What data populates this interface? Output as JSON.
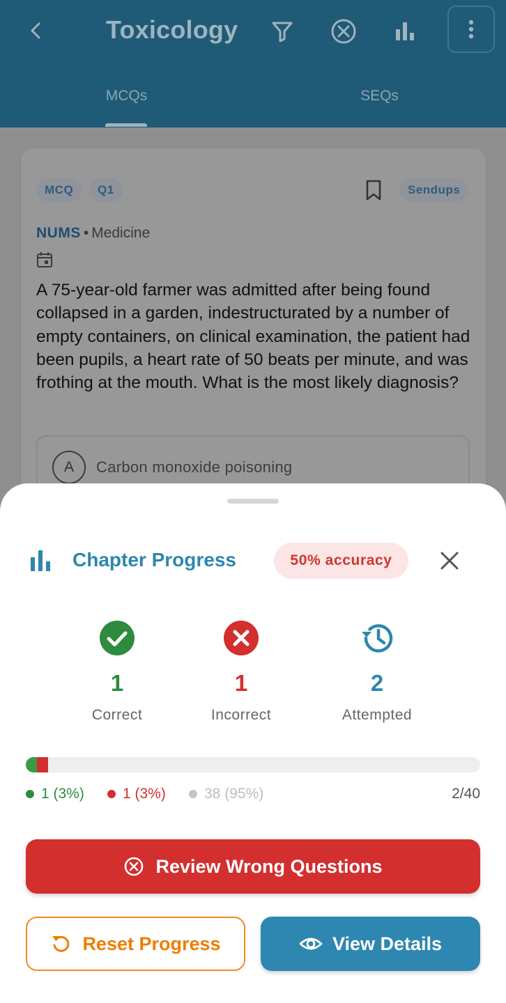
{
  "appbar": {
    "title": "Toxicology",
    "back_icon": "back-arrow-icon",
    "actions": [
      "filter-icon",
      "clear-circle-icon",
      "stats-chart-icon",
      "more-vertical-icon"
    ],
    "tabs": [
      {
        "label": "MCQs",
        "active": true
      },
      {
        "label": "SEQs",
        "active": false
      }
    ]
  },
  "question": {
    "type_chip": "MCQ",
    "number_chip": "Q1",
    "source_chip": "Sendups",
    "university": "NUMS",
    "subject": "Medicine",
    "separator": "•",
    "text": "A 75-year-old farmer was admitted after being found collapsed in a garden, indestructurated by a number of empty containers, on clinical examination, the patient had been pupils, a heart rate of 50 beats per minute, and was frothing at the mouth. What is the most likely diagnosis?",
    "options": [
      {
        "letter": "A",
        "text": "Carbon monoxide poisoning"
      }
    ]
  },
  "sheet": {
    "title": "Chapter Progress",
    "accuracy_badge": "50% accuracy",
    "stats": {
      "correct": {
        "value": "1",
        "label": "Correct",
        "color": "#2e8b3e"
      },
      "incorrect": {
        "value": "1",
        "label": "Incorrect",
        "color": "#d32f2f"
      },
      "attempted": {
        "value": "2",
        "label": "Attempted",
        "color": "#2e87ae"
      }
    },
    "progress": {
      "correct_fraction": 0.025,
      "incorrect_fraction": 0.025,
      "legend": {
        "correct": "1 (3%)",
        "incorrect": "1 (3%)",
        "unattempted": "38 (95%)"
      },
      "fraction_text": "2/40"
    },
    "buttons": {
      "review": "Review Wrong Questions",
      "reset": "Reset Progress",
      "view": "View Details"
    }
  },
  "colors": {
    "brand_blue": "#2e87ae",
    "appbar": "#1f5a76",
    "error_red": "#d32f2f",
    "success_green": "#2e8b3e",
    "warning_orange": "#ee7d00"
  }
}
